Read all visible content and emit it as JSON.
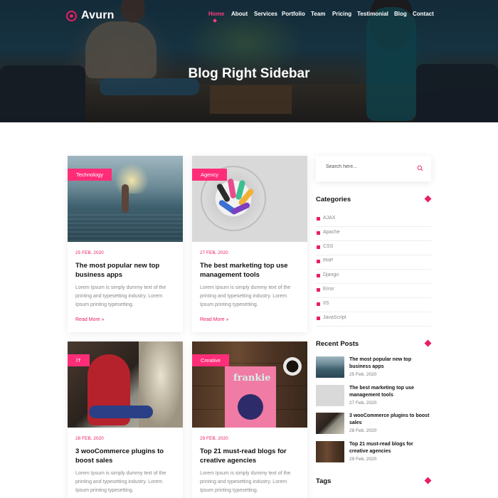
{
  "brand": {
    "name": "Avurn",
    "accent": "#e91e63"
  },
  "nav": {
    "items": [
      {
        "label": "Home",
        "active": true
      },
      {
        "label": "About"
      },
      {
        "label": "Services"
      },
      {
        "label": "Portfolio"
      },
      {
        "label": "Team"
      },
      {
        "label": "Pricing"
      },
      {
        "label": "Testimonial"
      },
      {
        "label": "Blog"
      },
      {
        "label": "Contact"
      }
    ]
  },
  "hero": {
    "title": "Blog Right Sidebar"
  },
  "posts": [
    {
      "category": "Technology",
      "date": "25 FEB, 2020",
      "title": "The most popular new top business apps",
      "excerpt": "Lorem Ipsum is simply dummy text of the printing and typesetting industry. Lorem Ipsum printing typesetting.",
      "read_more": "Read More »"
    },
    {
      "category": "Agency",
      "date": "27 FEB, 2020",
      "title": "The best marketing top use management tools",
      "excerpt": "Lorem Ipsum is simply dummy text of the printing and typesetting industry. Lorem Ipsum printing typesetting.",
      "read_more": "Read More »"
    },
    {
      "category": "IT",
      "date": "28 FEB, 2020",
      "title": "3 wooCommerce plugins to boost sales",
      "excerpt": "Lorem Ipsum is simply dummy text of the printing and typesetting industry. Lorem Ipsum printing typesetting."
    },
    {
      "category": "Creative",
      "date": "29 FEB, 2020",
      "title": "Top 21 must-read blogs for creative agencies",
      "excerpt": "Lorem Ipsum is simply dummy text of the printing and typesetting industry. Lorem Ipsum printing typesetting.",
      "image_text": "frankie"
    }
  ],
  "sidebar": {
    "search": {
      "placeholder": "Search here..."
    },
    "categories": {
      "title": "Categories",
      "items": [
        "AJAX",
        "Apache",
        "CSS",
        "PHP",
        "Django",
        "Error",
        "IIS",
        "JavaScript"
      ]
    },
    "recent_posts": {
      "title": "Recent Posts",
      "items": [
        {
          "title": "The most popular new top business apps",
          "date": "25 Feb, 2020"
        },
        {
          "title": "The best marketing top use management tools",
          "date": "27 Feb, 2020"
        },
        {
          "title": "3 wooCommerce plugins to boost sales",
          "date": "28 Feb, 2020"
        },
        {
          "title": "Top 21 must-read blogs for creative agencies",
          "date": "29 Feb, 2020"
        }
      ]
    },
    "tags": {
      "title": "Tags"
    }
  }
}
